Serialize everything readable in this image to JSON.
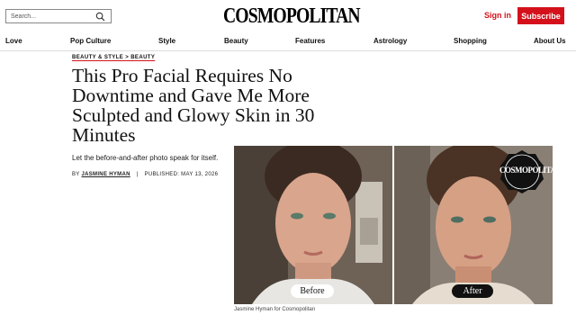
{
  "header": {
    "search_placeholder": "Search...",
    "logo": "COSMOPOLITAN",
    "signin": "Sign in",
    "subscribe": "Subscribe"
  },
  "nav": [
    "Love",
    "Pop Culture",
    "Style",
    "Beauty",
    "Features",
    "Astrology",
    "Shopping",
    "About Us"
  ],
  "article": {
    "breadcrumb": "BEAUTY & STYLE > BEAUTY",
    "title": "This Pro Facial Requires No Downtime and Gave Me More Sculpted and Glowy Skin in 30 Minutes",
    "dek": "Let the before-and-after photo speak for itself.",
    "by": "BY",
    "author": "JASMINE HYMAN",
    "separator": "|",
    "published": "PUBLISHED: MAY 13, 2026"
  },
  "image": {
    "before_label": "Before",
    "after_label": "After",
    "seal_text": "COSMOPOLITAN",
    "caption": "Jasmine Hyman for Cosmopolitan"
  },
  "colors": {
    "brand_red": "#d4111b",
    "text": "#111111"
  }
}
